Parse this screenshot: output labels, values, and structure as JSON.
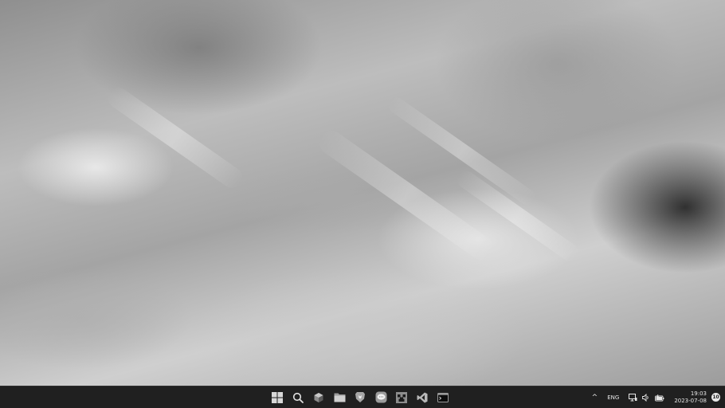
{
  "taskbar": {
    "pinned": [
      {
        "name": "start-icon"
      },
      {
        "name": "search-icon"
      },
      {
        "name": "task-view-icon"
      },
      {
        "name": "file-explorer-icon"
      },
      {
        "name": "brave-browser-icon"
      },
      {
        "name": "chat-app-icon"
      },
      {
        "name": "game-app-icon"
      },
      {
        "name": "vscode-icon"
      },
      {
        "name": "terminal-icon"
      }
    ],
    "tray": {
      "chevron": "^",
      "language": "ENG",
      "time": "19:03",
      "date": "2023-07-08",
      "notification_count": "10"
    }
  },
  "colors": {
    "taskbar_bg": "#202020",
    "icon_fg": "#e6e6e6"
  }
}
